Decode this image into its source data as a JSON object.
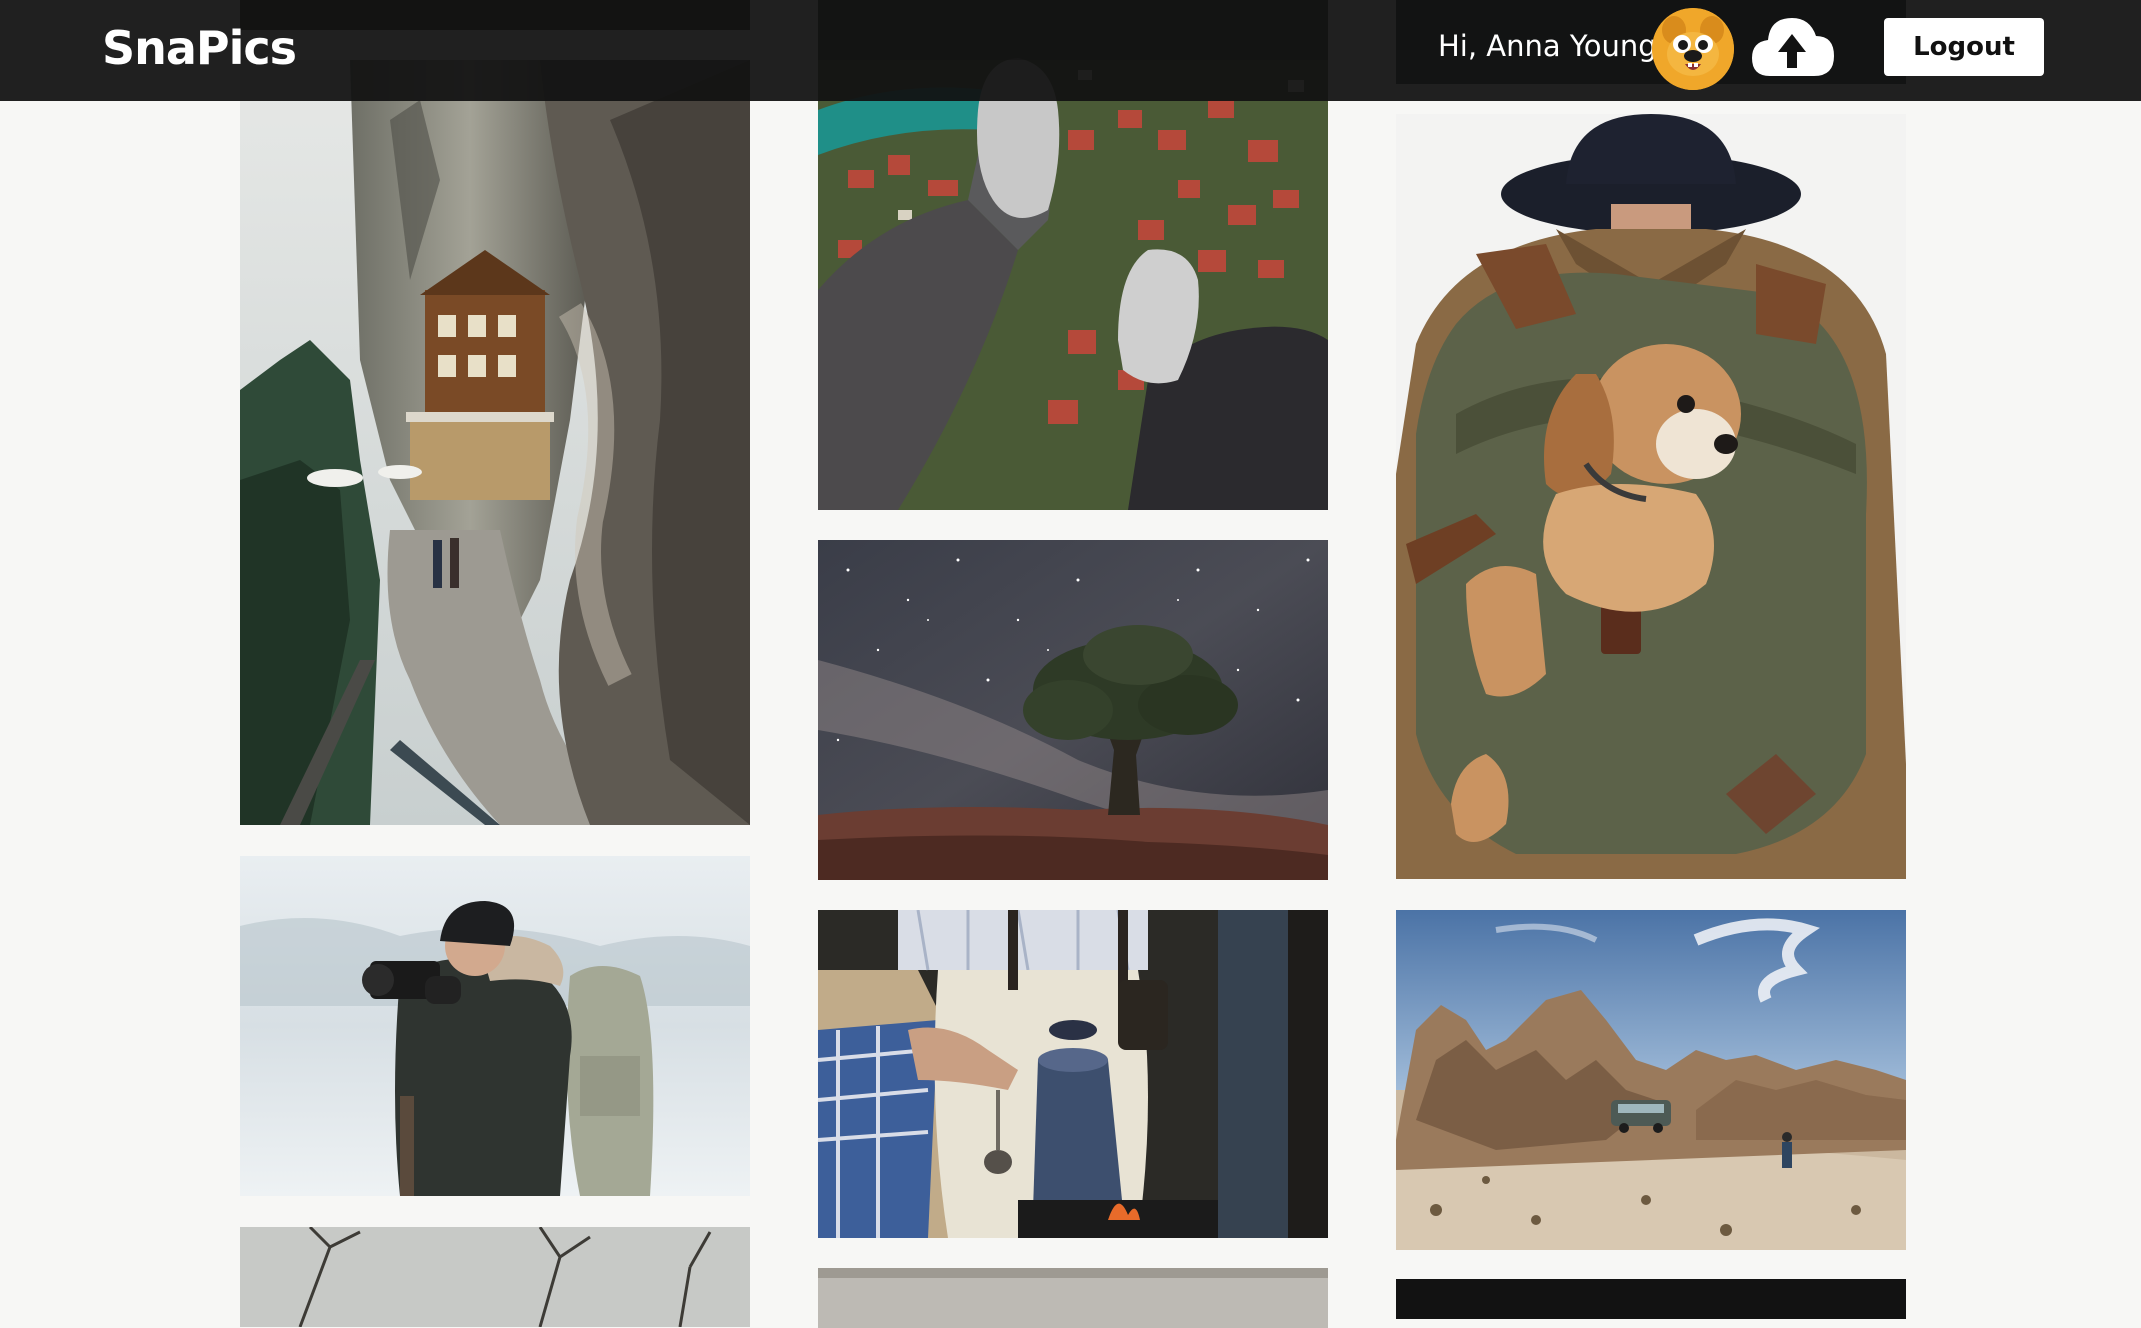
{
  "navbar": {
    "brand": "SnaPics",
    "greeting": "Hi, Anna Young",
    "avatar_icon": "cartoon-dog-avatar",
    "upload_icon": "cloud-upload-icon",
    "logout_label": "Logout"
  },
  "colors": {
    "navbar_bg": "#121212",
    "page_bg": "#f7f7f5",
    "avatar_bg": "#f0a72a",
    "button_bg": "#ffffff"
  },
  "gallery": {
    "columns": 3,
    "photos": [
      "partial-dark-photo",
      "cliffside-mountain-house",
      "photographer-in-snow",
      "partial-winter-trees",
      "aerial-feet-over-town",
      "tree-under-milky-way",
      "man-with-coffee-pot",
      "partial-light-photo",
      "partial-dark-landscape",
      "dog-in-backpack",
      "desert-rocks-with-van",
      "partial-dark-photo-bottom"
    ]
  }
}
